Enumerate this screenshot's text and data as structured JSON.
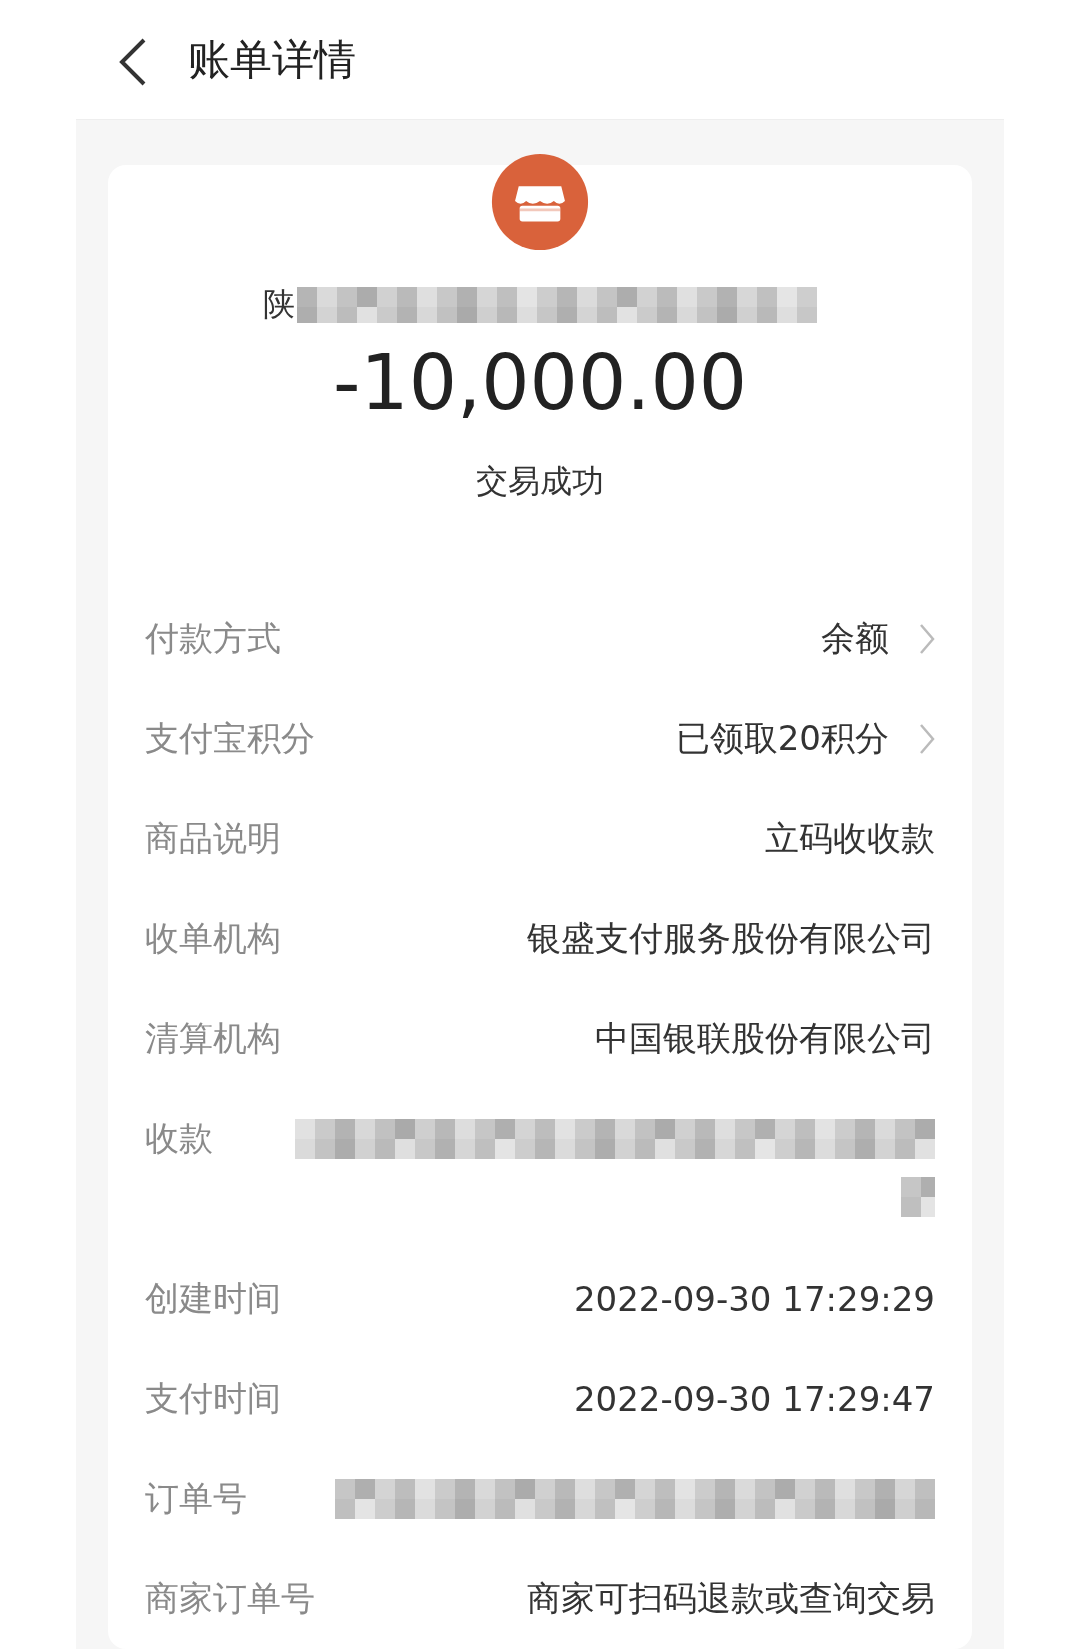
{
  "header": {
    "title": "账单详情"
  },
  "merchant": {
    "name_visible": "陕",
    "redacted": true
  },
  "amount": "-10,000.00",
  "status": "交易成功",
  "rows": [
    {
      "kind": "link",
      "label": "付款方式",
      "value": "余额"
    },
    {
      "kind": "link",
      "label": "支付宝积分",
      "value": "已领取20积分"
    },
    {
      "kind": "text",
      "label": "商品说明",
      "value": "立码收收款"
    },
    {
      "kind": "text",
      "label": "收单机构",
      "value": "银盛支付服务股份有限公司"
    },
    {
      "kind": "text",
      "label": "清算机构",
      "value": "中国银联股份有限公司"
    },
    {
      "kind": "redacted_two_line",
      "label": "收款"
    },
    {
      "kind": "text",
      "label": "创建时间",
      "value": "2022-09-30 17:29:29"
    },
    {
      "kind": "text",
      "label": "支付时间",
      "value": "2022-09-30 17:29:47"
    },
    {
      "kind": "redacted",
      "label": "订单号"
    },
    {
      "kind": "text",
      "label": "商家订单号",
      "value": "商家可扫码退款或查询交易"
    }
  ]
}
